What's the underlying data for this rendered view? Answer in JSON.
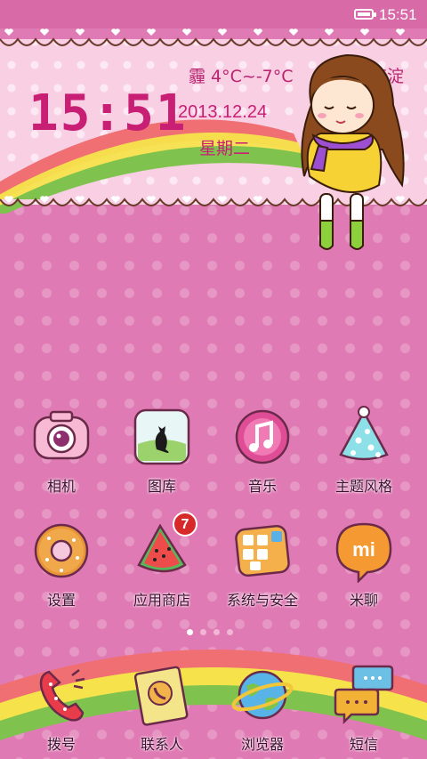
{
  "status_bar": {
    "time": "15:51",
    "battery_icon": "battery-icon"
  },
  "widget": {
    "weather": "霾 4°C~-7°C",
    "location": "海淀",
    "clock": "15:51",
    "date": "2013.12.24",
    "weekday": "星期二"
  },
  "apps": [
    {
      "label": "相机",
      "icon": "camera-icon"
    },
    {
      "label": "图库",
      "icon": "gallery-icon"
    },
    {
      "label": "音乐",
      "icon": "music-icon"
    },
    {
      "label": "主题风格",
      "icon": "theme-icon"
    },
    {
      "label": "设置",
      "icon": "settings-icon"
    },
    {
      "label": "应用商店",
      "icon": "app-store-icon",
      "badge": "7"
    },
    {
      "label": "系统与安全",
      "icon": "security-icon"
    },
    {
      "label": "米聊",
      "icon": "miliao-icon"
    }
  ],
  "dock": [
    {
      "label": "拨号",
      "icon": "phone-icon"
    },
    {
      "label": "联系人",
      "icon": "contacts-icon"
    },
    {
      "label": "浏览器",
      "icon": "browser-icon"
    },
    {
      "label": "短信",
      "icon": "sms-icon"
    }
  ],
  "page_indicator": {
    "pages": 4,
    "current": 1
  },
  "colors": {
    "background": "#e07ab4",
    "accent": "#c81e74"
  }
}
